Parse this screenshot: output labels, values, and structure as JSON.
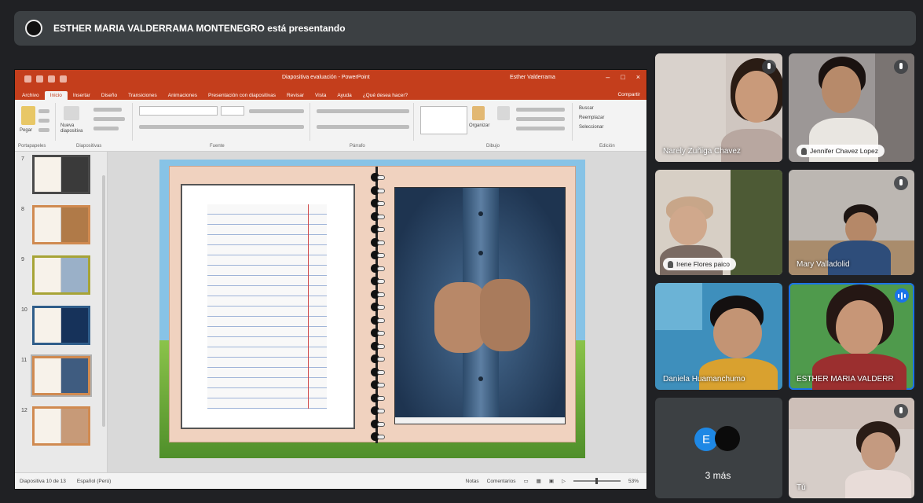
{
  "banner": {
    "text": "ESTHER MARIA VALDERRAMA MONTENEGRO está presentando",
    "avatar_icon": "presenter-avatar-icon"
  },
  "ppt": {
    "document_title": "Diapositiva evaluación - PowerPoint",
    "user_name": "Esther Valderrama",
    "menu_tabs": [
      "Archivo",
      "Inicio",
      "Insertar",
      "Diseño",
      "Transiciones",
      "Animaciones",
      "Presentación con diapositivas",
      "Revisar",
      "Vista",
      "Ayuda",
      "¿Qué desea hacer?"
    ],
    "active_tab": "Inicio",
    "share_label": "Compartir",
    "ribbon_groups": [
      "Portapapeles",
      "Diapositivas",
      "Fuente",
      "Párrafo",
      "Dibujo",
      "Edición"
    ],
    "ribbon_commands": {
      "paste": "Pegar",
      "new_slide": "Nueva diapositiva",
      "find": "Buscar",
      "replace": "Reemplazar",
      "select": "Seleccionar",
      "arrange": "Organizar"
    },
    "slide_numbers": [
      "7",
      "8",
      "9",
      "10",
      "11",
      "12"
    ],
    "status": {
      "slide_counter": "Diapositiva 10 de 13",
      "language": "Español (Perú)",
      "notes": "Notas",
      "comments": "Comentarios",
      "zoom": "53%"
    }
  },
  "participants": [
    {
      "name": "Narely Zuñiga Chavez",
      "muted": true
    },
    {
      "name": "Jennifer Chavez Lopez",
      "muted": true
    },
    {
      "name": "Irene Flores paico",
      "muted": false
    },
    {
      "name": "Mary Valladolid",
      "muted": true
    },
    {
      "name": "Daniela Huamanchumo",
      "muted": false
    },
    {
      "name": "ESTHER MARIA VALDERR",
      "speaking": true
    },
    {
      "name": "Tú",
      "muted": false
    }
  ],
  "more": {
    "initial": "E",
    "count_label": "3 más"
  },
  "colors": {
    "ppt_accent": "#c43e1c",
    "meet_bg": "#202124",
    "speaking_blue": "#1a73e8"
  }
}
